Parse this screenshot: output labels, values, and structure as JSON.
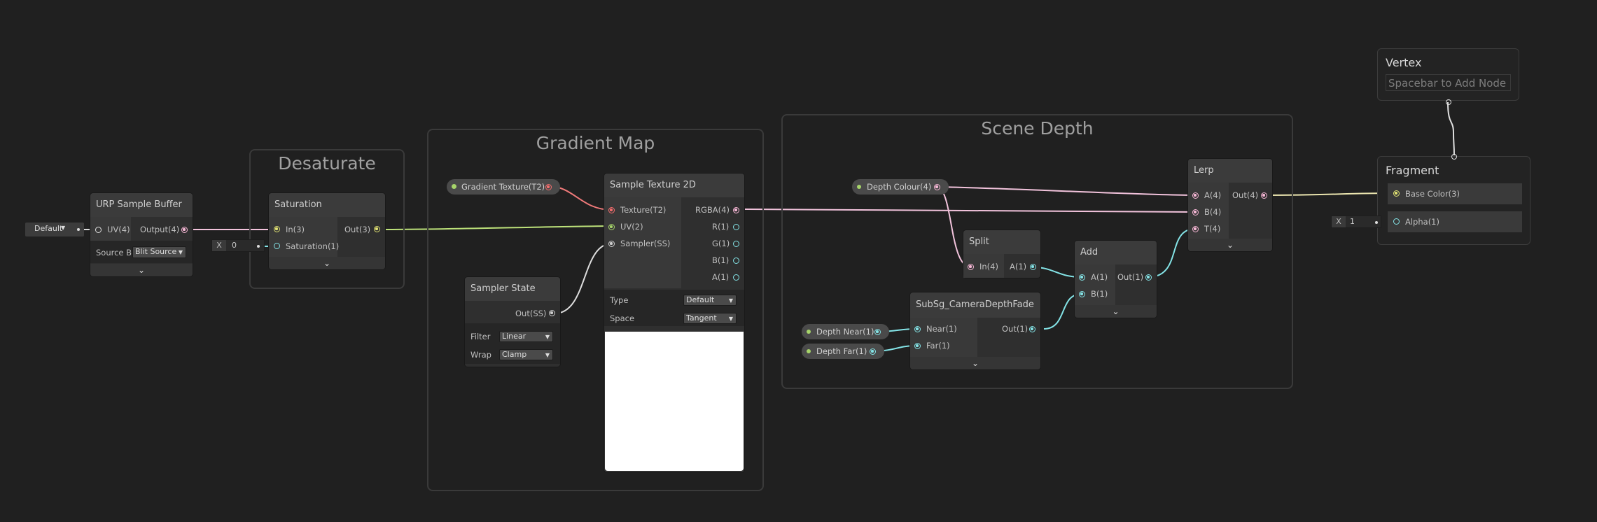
{
  "groups": {
    "desaturate": "Desaturate",
    "gradient_map": "Gradient Map",
    "scene_depth": "Scene Depth"
  },
  "urp_sample_buffer": {
    "title": "URP Sample Buffer",
    "uv_label": "UV(4)",
    "output_label": "Output(4)",
    "source_label": "Source Bu",
    "source_value": "Blit Source",
    "uv_default": "Default"
  },
  "saturation": {
    "title": "Saturation",
    "in_label": "In(3)",
    "sat_label": "Saturation(1)",
    "out_label": "Out(3)",
    "x_label": "X",
    "x_value": "0"
  },
  "sample_texture_2d": {
    "title": "Sample Texture 2D",
    "texture_label": "Texture(T2)",
    "uv_label": "UV(2)",
    "sampler_label": "Sampler(SS)",
    "rgba_label": "RGBA(4)",
    "r_label": "R(1)",
    "g_label": "G(1)",
    "b_label": "B(1)",
    "a_label": "A(1)",
    "type_label": "Type",
    "type_value": "Default",
    "space_label": "Space",
    "space_value": "Tangent"
  },
  "gradient_texture": "Gradient Texture(T2)",
  "sampler_state": {
    "title": "Sampler State",
    "out_label": "Out(SS)",
    "filter_label": "Filter",
    "filter_value": "Linear",
    "wrap_label": "Wrap",
    "wrap_value": "Clamp"
  },
  "depth_colour": "Depth Colour(4)",
  "depth_near": "Depth Near(1)",
  "depth_far": "Depth Far(1)",
  "split": {
    "title": "Split",
    "in_label": "In(4)",
    "out_label": "A(1)"
  },
  "add": {
    "title": "Add",
    "a_label": "A(1)",
    "b_label": "B(1)",
    "out_label": "Out(1)"
  },
  "camera_depth_fade": {
    "title": "SubSg_CameraDepthFade",
    "near_label": "Near(1)",
    "far_label": "Far(1)",
    "out_label": "Out(1)"
  },
  "lerp": {
    "title": "Lerp",
    "a_label": "A(4)",
    "b_label": "B(4)",
    "t_label": "T(4)",
    "out_label": "Out(4)"
  },
  "vertex": {
    "title": "Vertex",
    "placeholder": "Spacebar to Add Node"
  },
  "fragment": {
    "title": "Fragment",
    "base_color_label": "Base Color(3)",
    "alpha_label": "Alpha(1)",
    "alpha_x_label": "X",
    "alpha_value": "1"
  },
  "icons": {
    "collapse": "⌄",
    "dropdown": "▼"
  },
  "colors": {
    "background": "#202020",
    "node": "#2f2f2f",
    "vector4": "#f7b7d6",
    "vector3": "#dfe072",
    "vector2": "#a6d46a",
    "vector1": "#84e4e7",
    "texture": "#f46d6d"
  }
}
